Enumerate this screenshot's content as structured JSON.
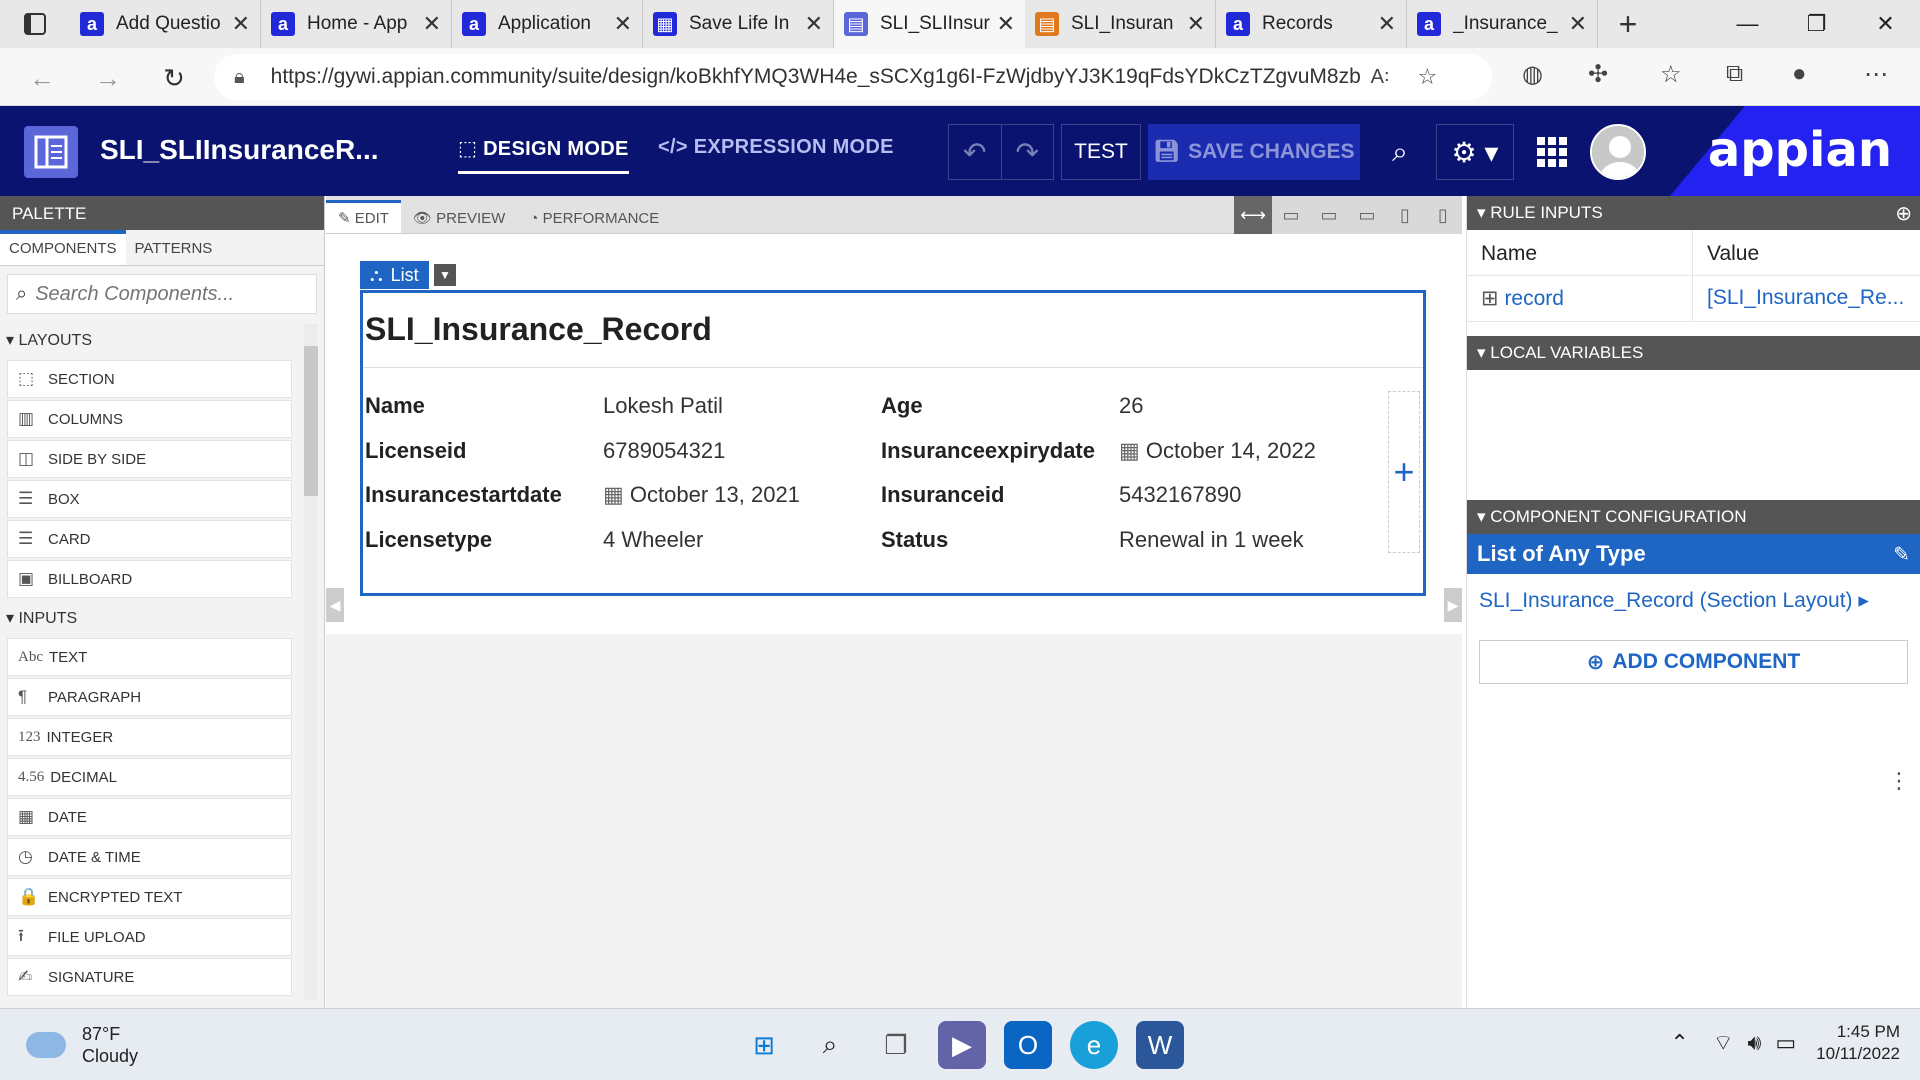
{
  "browser": {
    "tabs": [
      {
        "title": "Add Questio",
        "favicon": "appian-a",
        "color": "#2229d8"
      },
      {
        "title": "Home - App",
        "favicon": "appian-a",
        "color": "#2229d8"
      },
      {
        "title": "Application",
        "favicon": "appian-a",
        "color": "#2229d8"
      },
      {
        "title": "Save Life In",
        "favicon": "grid-icon",
        "color": "#2229d8"
      },
      {
        "title": "SLI_SLIInsur",
        "favicon": "interface-icon",
        "color": "#5b66d8"
      },
      {
        "title": "SLI_Insuran",
        "favicon": "record-icon",
        "color": "#e0781e"
      },
      {
        "title": "Records",
        "favicon": "appian-a",
        "color": "#2229d8"
      },
      {
        "title": "_Insurance_",
        "favicon": "appian-a",
        "color": "#2229d8"
      }
    ],
    "url": "https://gywi.appian.community/suite/design/koBkhfYMQ3WH4e_sSCXg1g6I-FzWjdbyYJ3K19qFdsYDkCzTZgvuM8zb..."
  },
  "appbar": {
    "title": "SLI_SLIInsuranceR...",
    "design_mode": "DESIGN MODE",
    "expression_mode": "EXPRESSION MODE",
    "test": "TEST",
    "save": "SAVE CHANGES",
    "brand": "appian"
  },
  "palette": {
    "title": "PALETTE",
    "tabs": [
      "COMPONENTS",
      "PATTERNS"
    ],
    "search_placeholder": "Search Components...",
    "layouts_label": "LAYOUTS",
    "layouts": [
      {
        "icon": "section-icon",
        "glyph": "⬚",
        "label": "SECTION"
      },
      {
        "icon": "columns-icon",
        "glyph": "▥",
        "label": "COLUMNS"
      },
      {
        "icon": "side-by-side-icon",
        "glyph": "◫",
        "label": "SIDE BY SIDE"
      },
      {
        "icon": "box-icon",
        "glyph": "☰",
        "label": "BOX"
      },
      {
        "icon": "card-icon",
        "glyph": "☰",
        "label": "CARD"
      },
      {
        "icon": "billboard-icon",
        "glyph": "▣",
        "label": "BILLBOARD"
      }
    ],
    "inputs_label": "INPUTS",
    "inputs": [
      {
        "icon": "text-icon",
        "glyph": "Abc",
        "label": "TEXT"
      },
      {
        "icon": "paragraph-icon",
        "glyph": "¶",
        "label": "PARAGRAPH"
      },
      {
        "icon": "integer-icon",
        "glyph": "123",
        "label": "INTEGER"
      },
      {
        "icon": "decimal-icon",
        "glyph": "4.56",
        "label": "DECIMAL"
      },
      {
        "icon": "date-icon",
        "glyph": "▦",
        "label": "DATE"
      },
      {
        "icon": "date-time-icon",
        "glyph": "◷",
        "label": "DATE & TIME"
      },
      {
        "icon": "lock-icon",
        "glyph": "🔒",
        "label": "ENCRYPTED TEXT"
      },
      {
        "icon": "upload-icon",
        "glyph": "⭱",
        "label": "FILE UPLOAD"
      },
      {
        "icon": "signature-icon",
        "glyph": "✍",
        "label": "SIGNATURE"
      }
    ]
  },
  "canvas": {
    "tabs": [
      "EDIT",
      "PREVIEW",
      "PERFORMANCE"
    ],
    "list_chip": "List",
    "section_title": "SLI_Insurance_Record",
    "fields": [
      {
        "label": "Name",
        "value": "Lokesh Patil",
        "date": false
      },
      {
        "label": "Age",
        "value": "26",
        "date": false
      },
      {
        "label": "Licenseid",
        "value": "6789054321",
        "date": false
      },
      {
        "label": "Insuranceexpirydate",
        "value": "October 14, 2022",
        "date": true
      },
      {
        "label": "Insurancestartdate",
        "value": "October 13, 2021",
        "date": true
      },
      {
        "label": "Insuranceid",
        "value": "5432167890",
        "date": false
      },
      {
        "label": "Licensetype",
        "value": "4 Wheeler",
        "date": false
      },
      {
        "label": "Status",
        "value": "Renewal in 1 week",
        "date": false
      }
    ]
  },
  "right_panel": {
    "rule_inputs_label": "RULE INPUTS",
    "col_name": "Name",
    "col_value": "Value",
    "rule_input_name": "record",
    "rule_input_value": "[SLI_Insurance_Re...",
    "local_variables_label": "LOCAL VARIABLES",
    "component_config_label": "COMPONENT CONFIGURATION",
    "component_type": "List of Any Type",
    "component_child": "SLI_Insurance_Record (Section Layout)",
    "add_component": "ADD COMPONENT"
  },
  "taskbar": {
    "temp": "87°F",
    "weather": "Cloudy",
    "time": "1:45 PM",
    "date": "10/11/2022"
  }
}
